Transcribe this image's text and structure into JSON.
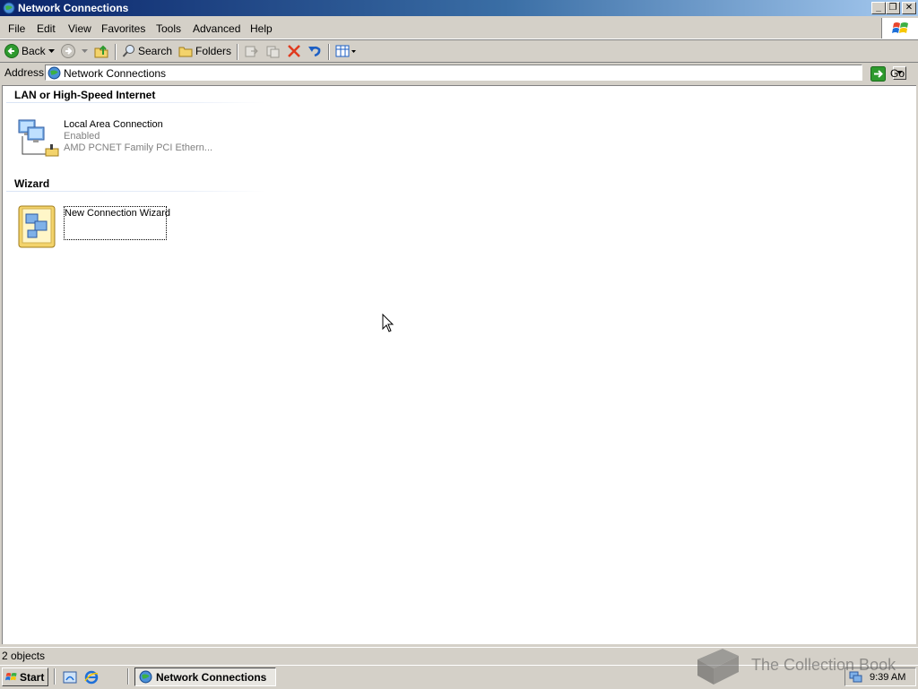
{
  "window": {
    "title": "Network Connections",
    "buttons": {
      "minimize": "_",
      "restore": "❐",
      "close": "✕"
    }
  },
  "menu": [
    {
      "label": "File"
    },
    {
      "label": "Edit"
    },
    {
      "label": "View"
    },
    {
      "label": "Favorites"
    },
    {
      "label": "Tools"
    },
    {
      "label": "Advanced"
    },
    {
      "label": "Help"
    }
  ],
  "toolbar": {
    "back_label": "Back",
    "search_label": "Search",
    "folders_label": "Folders"
  },
  "address": {
    "label": "Address",
    "value": "Network Connections",
    "go_label": "Go"
  },
  "groups": {
    "lan": {
      "header": "LAN or High-Speed Internet",
      "item": {
        "name": "Local Area Connection",
        "status": "Enabled",
        "device": "AMD PCNET Family PCI Ethern..."
      }
    },
    "wizard": {
      "header": "Wizard",
      "item": {
        "name": "New Connection Wizard"
      }
    }
  },
  "status": {
    "text": "2 objects"
  },
  "taskbar": {
    "start_label": "Start",
    "task_label": "Network Connections",
    "clock": "9:39 AM"
  },
  "watermark": {
    "text": "The Collection Book"
  },
  "colors": {
    "title_start": "#0a246a",
    "title_end": "#a6caf0",
    "face": "#d4d0c8",
    "window_bg": "#ffffff"
  }
}
